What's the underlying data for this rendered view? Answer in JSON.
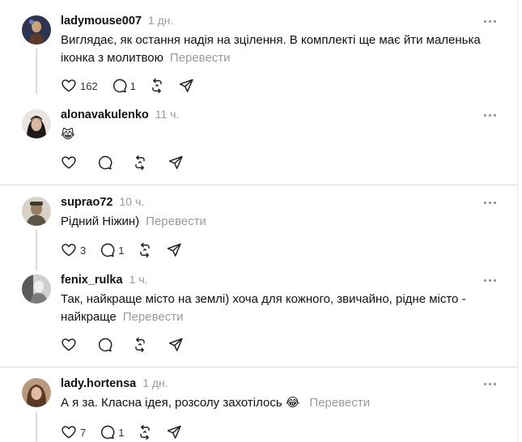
{
  "posts": [
    {
      "username": "ladymouse007",
      "time": "1 дн.",
      "text": "Виглядає, як остання надія на зцілення. В комплекті ще має йти маленька іконка з молитвою",
      "translate": "Перевести",
      "likes": "162",
      "replies": "1",
      "avatar_color": "#3a3f5a"
    },
    {
      "username": "alonavakulenko",
      "time": "11 ч.",
      "text": "😹",
      "translate": "",
      "likes": "",
      "replies": "",
      "avatar_color": "#2b2424"
    },
    {
      "username": "suprao72",
      "time": "10 ч.",
      "text": "Рідний Ніжин)",
      "translate": "Перевести",
      "likes": "3",
      "replies": "1",
      "avatar_color": "#8a7a66"
    },
    {
      "username": "fenix_rulka",
      "time": "1 ч.",
      "text": "Так, найкраще місто на землі) хоча для кожного, звичайно, рідне місто - найкраще",
      "translate": "Перевести",
      "likes": "",
      "replies": "",
      "avatar_color": "#9a9a9a"
    },
    {
      "username": "lady.hortensa",
      "time": "1 дн.",
      "text": "А я за. Класна ідея, розсолу захотілось 😂",
      "translate": "Перевести",
      "likes": "7",
      "replies": "1",
      "avatar_color": "#6b4a35"
    }
  ],
  "icons": {
    "like": "heart-icon",
    "reply": "comment-icon",
    "repost": "repost-icon",
    "share": "share-icon",
    "more": "more-icon"
  }
}
